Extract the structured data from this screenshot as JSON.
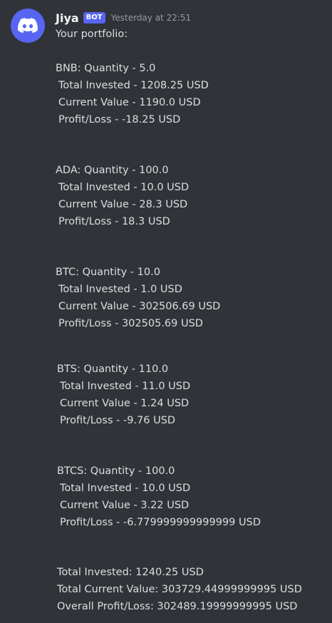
{
  "message": {
    "username": "Jiya",
    "badge": "BOT",
    "timestamp": "Yesterday at 22:51",
    "intro": "Your portfolio:",
    "holdings": [
      {
        "header": "BNB: Quantity - 5.0",
        "invested": "Total Invested - 1208.25 USD",
        "current": "Current Value - 1190.0 USD",
        "profit": "Profit/Loss - -18.25 USD"
      },
      {
        "header": "ADA: Quantity - 100.0",
        "invested": "Total Invested - 10.0 USD",
        "current": "Current Value - 28.3 USD",
        "profit": "Profit/Loss - 18.3 USD"
      },
      {
        "header": "BTC: Quantity - 10.0",
        "invested": "Total Invested - 1.0 USD",
        "current": "Current Value - 302506.69 USD",
        "profit": "Profit/Loss - 302505.69 USD"
      },
      {
        "header": "BTS: Quantity - 110.0",
        "invested": "Total Invested - 11.0 USD",
        "current": "Current Value - 1.24 USD",
        "profit": "Profit/Loss - -9.76 USD"
      },
      {
        "header": "BTCS: Quantity - 100.0",
        "invested": "Total Invested - 10.0 USD",
        "current": "Current Value - 3.22 USD",
        "profit": "Profit/Loss - -6.779999999999999 USD"
      }
    ],
    "summary": {
      "total_invested": "Total Invested: 1240.25 USD",
      "total_current": "Total Current Value: 303729.44999999995 USD",
      "overall_profit": "Overall Profit/Loss: 302489.19999999995 USD"
    }
  },
  "icons": {
    "avatar": "discord-logo-icon"
  },
  "colors": {
    "background": "#313338",
    "text": "#dbdee1",
    "username": "#f2f3f5",
    "badge": "#5865f2",
    "timestamp": "#949ba4"
  }
}
